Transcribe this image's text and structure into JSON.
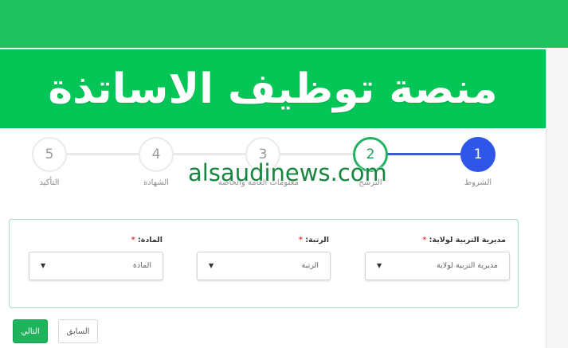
{
  "banner": {
    "title": "منصة توظيف الاساتذة"
  },
  "steps": [
    {
      "number": "1",
      "label": "الشروط"
    },
    {
      "number": "2",
      "label": "الترشح"
    },
    {
      "number": "3",
      "label": "معلومات العامة والخاصة"
    },
    {
      "number": "4",
      "label": "الشهادة"
    },
    {
      "number": "5",
      "label": "التأكيد"
    }
  ],
  "watermark": "alsaudinews.com",
  "form": {
    "directorate": {
      "label": "مديرية التربية لولاية:",
      "required_mark": "*",
      "placeholder": "مديرية التربية لولاية"
    },
    "rank": {
      "label": "الرتبة:",
      "required_mark": "*",
      "placeholder": "الرتبة"
    },
    "subject": {
      "label": "المادة:",
      "required_mark": "*",
      "placeholder": "المادة"
    }
  },
  "buttons": {
    "next": "التالي",
    "previous": "السابق"
  },
  "colors": {
    "brand_green": "#04c656",
    "active_blue": "#2f56e8",
    "card_border": "#a7dcbc"
  }
}
